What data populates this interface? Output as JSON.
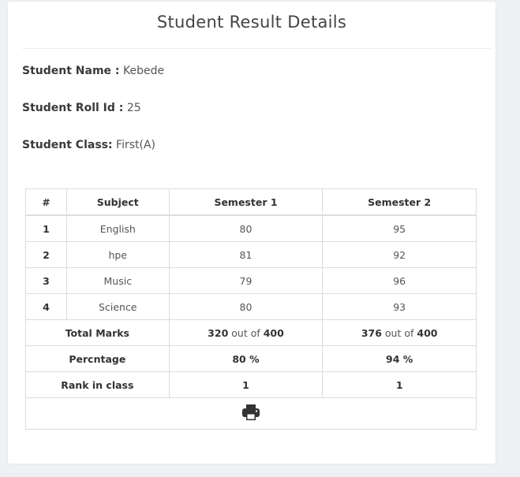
{
  "title": "Student Result Details",
  "student": {
    "name_label": "Student Name :",
    "name": "Kebede",
    "roll_label": "Student Roll Id :",
    "roll": "25",
    "class_label": "Student Class:",
    "class": "First(A)"
  },
  "table": {
    "headers": [
      "#",
      "Subject",
      "Semester 1",
      "Semester 2"
    ],
    "rows": [
      {
        "num": "1",
        "subject": "English",
        "s1": "80",
        "s2": "95"
      },
      {
        "num": "2",
        "subject": "hpe",
        "s1": "81",
        "s2": "92"
      },
      {
        "num": "3",
        "subject": "Music",
        "s1": "79",
        "s2": "96"
      },
      {
        "num": "4",
        "subject": "Science",
        "s1": "80",
        "s2": "93"
      }
    ],
    "total": {
      "label": "Total Marks",
      "s1_marks": "320",
      "s1_mid": "out of",
      "s1_max": "400",
      "s2_marks": "376",
      "s2_mid": "out of",
      "s2_max": "400"
    },
    "percentage": {
      "label": "Percntage",
      "s1": "80 %",
      "s2": "94 %"
    },
    "rank": {
      "label": "Rank in class",
      "s1": "1",
      "s2": "1"
    }
  },
  "icons": {
    "print": "print-icon"
  }
}
